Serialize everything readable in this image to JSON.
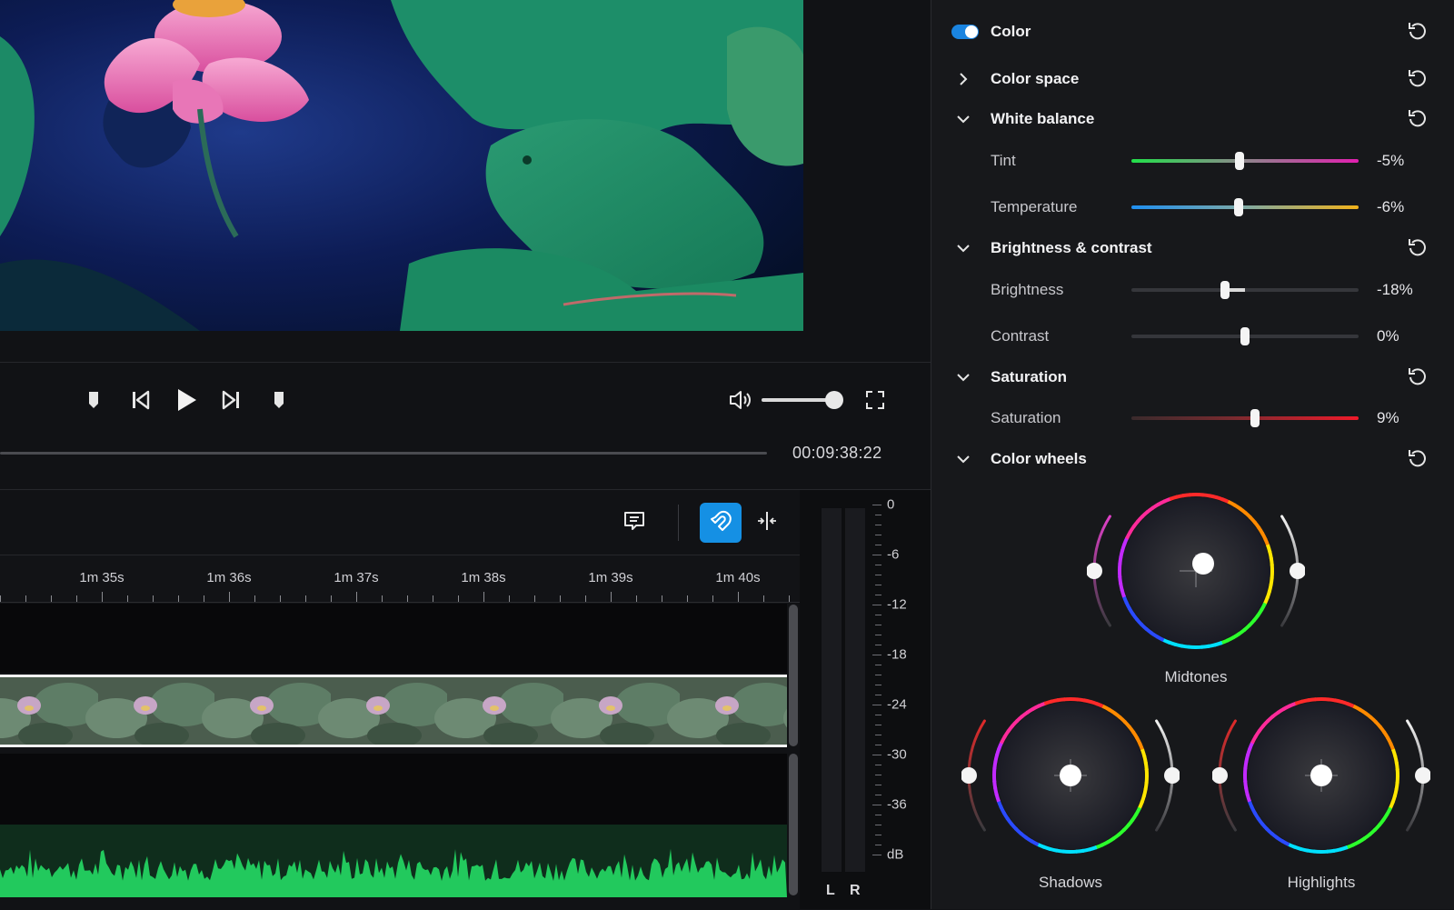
{
  "player": {
    "timecode": "00:09:38:22",
    "volume_level": 1.0
  },
  "timeline": {
    "ruler_labels": [
      "1m 35s",
      "1m 36s",
      "1m 37s",
      "1m 38s",
      "1m 39s",
      "1m 40s"
    ],
    "toolbar": {
      "comment_icon": "comment-icon",
      "magnet_icon": "magnet-icon",
      "split_icon": "split-icon",
      "magnet_active_color": "#1590e4"
    }
  },
  "meter": {
    "left_label": "L",
    "right_label": "R",
    "db_labels": [
      "0",
      "-6",
      "-12",
      "-18",
      "-24",
      "-30",
      "-36",
      "dB"
    ]
  },
  "panel": {
    "color": {
      "title": "Color",
      "enabled": true
    },
    "color_space": {
      "title": "Color space",
      "expanded": false
    },
    "white_balance": {
      "title": "White balance",
      "tint": {
        "label": "Tint",
        "value": "-5%",
        "level": -0.05
      },
      "temperature": {
        "label": "Temperature",
        "value": "-6%",
        "level": -0.06
      }
    },
    "brightness_contrast": {
      "title": "Brightness & contrast",
      "brightness": {
        "label": "Brightness",
        "value": "-18%",
        "level": -0.18
      },
      "contrast": {
        "label": "Contrast",
        "value": "0%",
        "level": 0.0
      }
    },
    "saturation": {
      "title": "Saturation",
      "saturation": {
        "label": "Saturation",
        "value": "9%",
        "level": 0.09
      }
    },
    "color_wheels": {
      "title": "Color wheels",
      "midtones": "Midtones",
      "shadows": "Shadows",
      "highlights": "Highlights"
    }
  }
}
